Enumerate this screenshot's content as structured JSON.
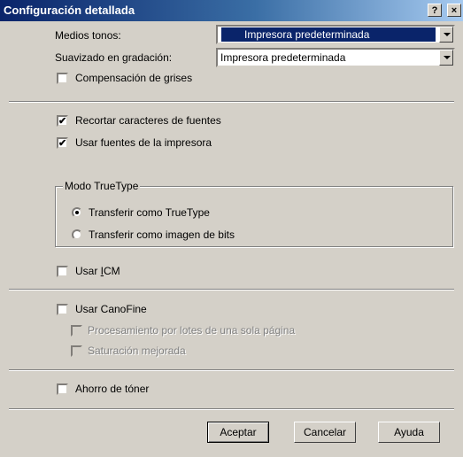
{
  "window": {
    "title": "Configuración detallada",
    "help_button": "?",
    "close_button": "×"
  },
  "settings": {
    "halftone": {
      "label": "Medios tonos:",
      "value": "Impresora predeterminada"
    },
    "gradation": {
      "label": "Suavizado en gradación:",
      "value": "Impresora predeterminada"
    },
    "gray_compensation": {
      "label": "Compensación de grises",
      "checked": false
    },
    "clip_font_chars": {
      "label": "Recortar caracteres de fuentes",
      "checked": true
    },
    "use_printer_fonts": {
      "label": "Usar fuentes de la impresora",
      "checked": true
    },
    "truetype_mode": {
      "group_label": "Modo TrueType",
      "option_truetype": "Transferir como TrueType",
      "option_bitmap": "Transferir como imagen de bits",
      "selected": "truetype"
    },
    "use_icm": {
      "label": "Usar ICM",
      "checked": false
    },
    "use_canofine": {
      "label": "Usar CanoFine",
      "checked": false
    },
    "batch_processing": {
      "label": "Procesamiento por lotes de una sola página",
      "checked": false,
      "enabled": false
    },
    "enhanced_saturation": {
      "label": "Saturación mejorada",
      "checked": false,
      "enabled": false
    },
    "toner_saving": {
      "label": "Ahorro de tóner",
      "checked": false
    }
  },
  "buttons": {
    "ok": "Aceptar",
    "cancel": "Cancelar",
    "help": "Ayuda"
  }
}
